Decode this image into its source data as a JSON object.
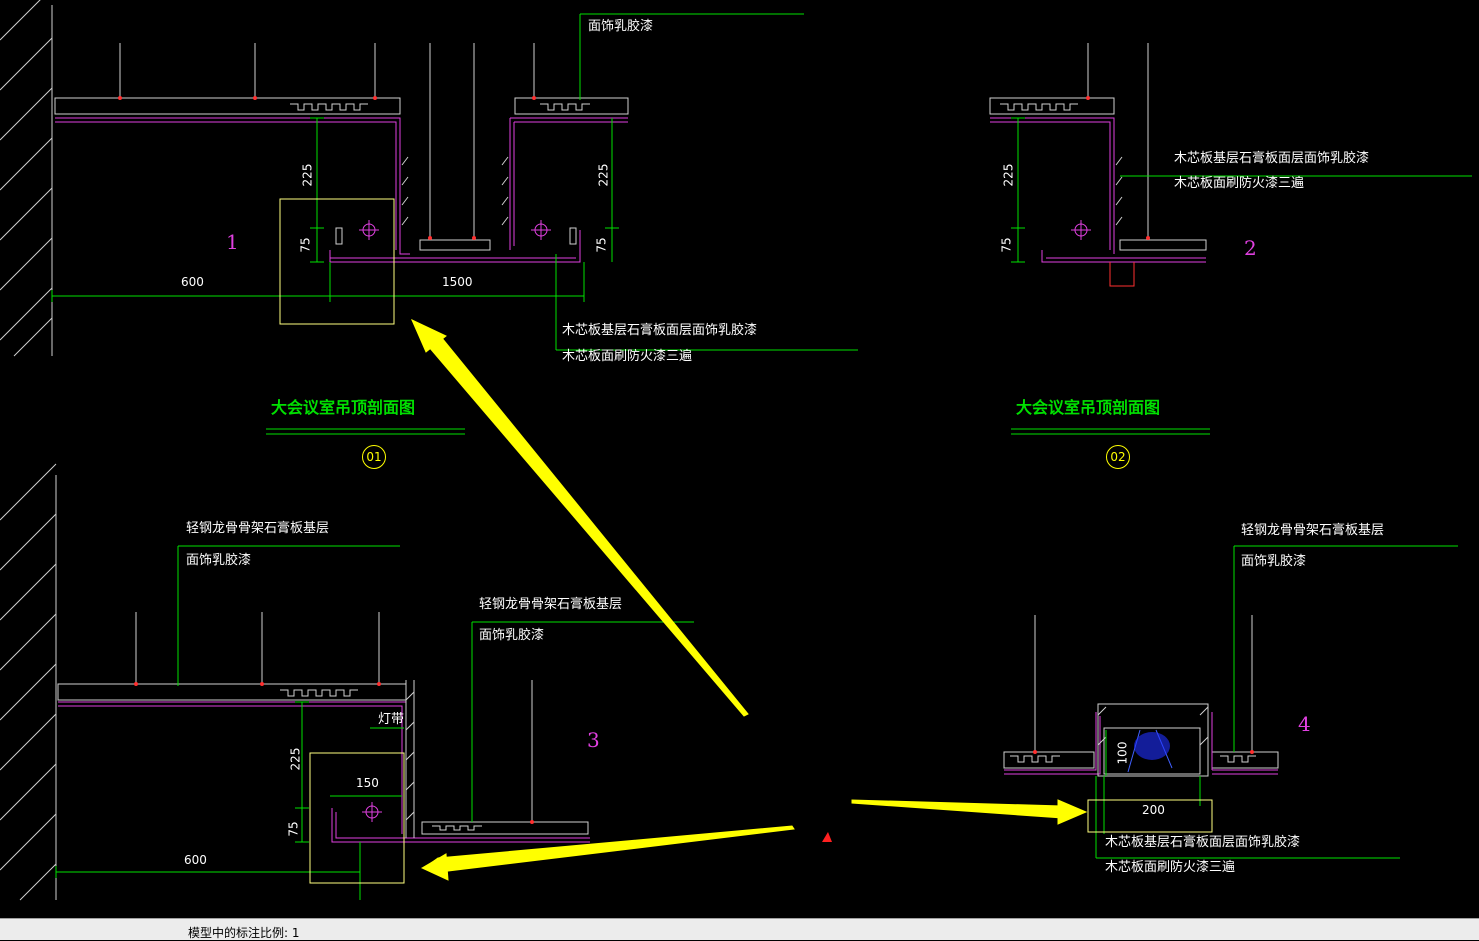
{
  "drawing": {
    "detail1": {
      "number": "1",
      "note_top": "面饰乳胶漆",
      "note_bottom_1": "木芯板基层石膏板面层面饰乳胶漆",
      "note_bottom_2": "木芯板面刷防火漆三遍",
      "dims": {
        "d225a": "225",
        "d75a": "75",
        "d600": "600",
        "d1500": "1500",
        "d225b": "225",
        "d75b": "75"
      }
    },
    "detail2": {
      "number": "2",
      "note_1": "木芯板基层石膏板面层面饰乳胶漆",
      "note_2": "木芯板面刷防火漆三遍",
      "dims": {
        "d225": "225",
        "d75": "75"
      }
    },
    "detail3": {
      "number": "3",
      "note_a1": "轻钢龙骨骨架石膏板基层",
      "note_a2": "面饰乳胶漆",
      "note_b1": "轻钢龙骨骨架石膏板基层",
      "note_b2": "面饰乳胶漆",
      "light_label": "灯带",
      "dims": {
        "d225": "225",
        "d75": "75",
        "d150": "150",
        "d600": "600"
      }
    },
    "detail4": {
      "number": "4",
      "note_a1": "轻钢龙骨骨架石膏板基层",
      "note_a2": "面饰乳胶漆",
      "note_b1": "木芯板基层石膏板面层面饰乳胶漆",
      "note_b2": "木芯板面刷防火漆三遍",
      "dims": {
        "d100": "100",
        "d200": "200"
      }
    },
    "section_title_1": "大会议室吊顶剖面图",
    "section_badge_1": "01",
    "section_title_2": "大会议室吊顶剖面图",
    "section_badge_2": "02"
  },
  "statusbar": {
    "text": "模型中的标注比例: 1"
  },
  "colors": {
    "background": "#000000",
    "ceiling_line": "#e040e0",
    "leader_line": "#00e000",
    "highlight_box": "#ffff80",
    "arrow": "#ffff00"
  }
}
